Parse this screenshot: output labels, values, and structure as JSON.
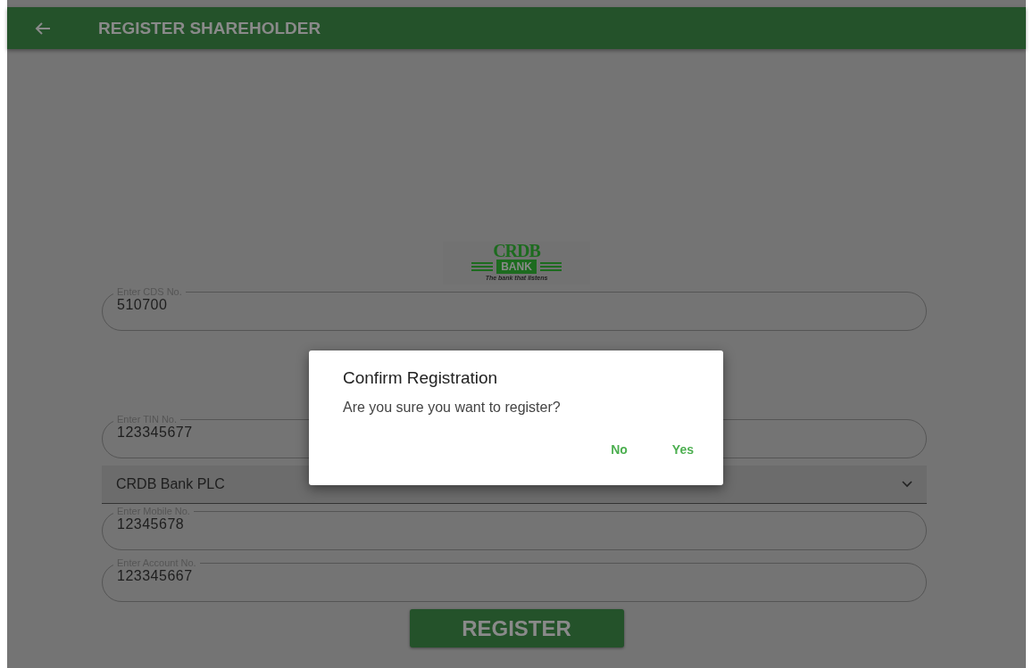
{
  "app_bar": {
    "title": "REGISTER SHAREHOLDER"
  },
  "logo": {
    "name": "CRDB",
    "badge": "BANK",
    "tagline": "The bank that listens"
  },
  "fields": [
    {
      "kind": "text",
      "label": "Enter CDS No.",
      "value": "510700"
    },
    {
      "kind": "spacer"
    },
    {
      "kind": "text",
      "label": "Enter TIN No.",
      "value": "123345677"
    },
    {
      "kind": "dropdown",
      "value": "CRDB Bank PLC"
    },
    {
      "kind": "text",
      "label": "Enter Mobile No.",
      "value": "12345678"
    },
    {
      "kind": "text",
      "label": "Enter Account No.",
      "value": "123345667"
    }
  ],
  "register_button": "REGISTER",
  "dialog": {
    "title": "Confirm Registration",
    "message": "Are you sure you want to register?",
    "buttons": [
      "No",
      "Yes"
    ]
  }
}
